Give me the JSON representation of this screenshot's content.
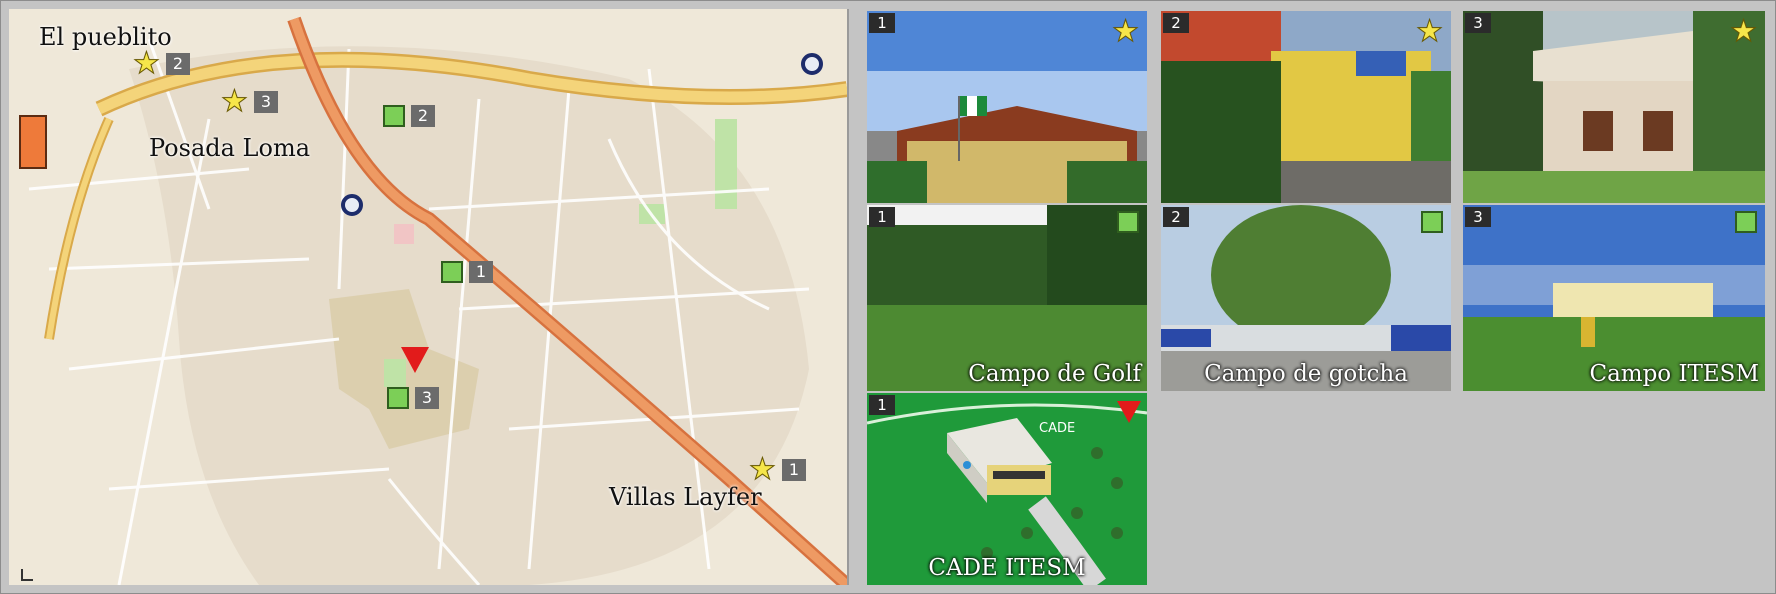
{
  "map": {
    "labels": {
      "el_pueblito": "El pueblito",
      "posada_loma": "Posada Loma",
      "villas_layfer": "Villas Layfer"
    },
    "markers": {
      "star_1": "1",
      "star_2": "2",
      "star_3": "3",
      "square_1": "1",
      "square_2": "2",
      "square_3": "3"
    }
  },
  "tiles": {
    "hotel_1": {
      "index": "1",
      "badge": "star"
    },
    "hotel_2": {
      "index": "2",
      "badge": "star"
    },
    "hotel_3": {
      "index": "3",
      "badge": "star"
    },
    "field_1": {
      "index": "1",
      "badge": "square",
      "caption": "Campo de Golf"
    },
    "field_2": {
      "index": "2",
      "badge": "square",
      "caption": "Campo de gotcha"
    },
    "field_3": {
      "index": "3",
      "badge": "square",
      "caption": "Campo ITESM"
    },
    "cade_1": {
      "index": "1",
      "badge": "triangle",
      "caption": "CADE ITESM",
      "inner_label": "CADE"
    }
  },
  "colors": {
    "star": "#f6e64a",
    "square": "#7ccf57",
    "triangle": "#e21b1b",
    "main_road": "#e9915a",
    "highway": "#f2d070"
  }
}
